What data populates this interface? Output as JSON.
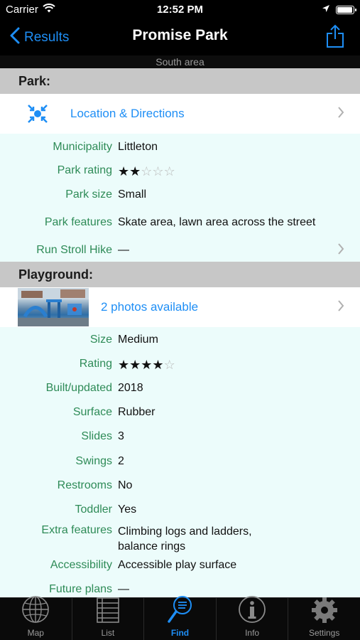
{
  "status_bar": {
    "carrier": "Carrier",
    "time": "12:52 PM",
    "battery_level": 0.95
  },
  "nav": {
    "back_label": "Results",
    "title": "Promise Park",
    "subtitle": "South area"
  },
  "park": {
    "header": "Park:",
    "directions_label": "Location & Directions",
    "rows": [
      {
        "label": "Municipality",
        "value": "Littleton"
      },
      {
        "label": "Park rating",
        "stars": 2,
        "max_stars": 5
      },
      {
        "label": "Park size",
        "value": "Small"
      },
      {
        "label": "Park features",
        "value": "Skate area, lawn area across the street"
      },
      {
        "label": "Run Stroll Hike",
        "value": "—"
      }
    ]
  },
  "playground": {
    "header": "Playground:",
    "photos_label": "2 photos available",
    "rows": [
      {
        "label": "Size",
        "value": "Medium"
      },
      {
        "label": "Rating",
        "stars": 4,
        "max_stars": 5
      },
      {
        "label": "Built/updated",
        "value": "2018"
      },
      {
        "label": "Surface",
        "value": "Rubber"
      },
      {
        "label": "Slides",
        "value": "3"
      },
      {
        "label": "Swings",
        "value": "2"
      },
      {
        "label": "Restrooms",
        "value": "No"
      },
      {
        "label": "Toddler",
        "value": "Yes"
      },
      {
        "label": "Extra features",
        "value_line1": "Climbing logs and ladders,",
        "value_line2": "balance rings"
      },
      {
        "label": "Accessibility",
        "value": "Accessible play surface"
      },
      {
        "label": "Future plans",
        "value": "—"
      }
    ]
  },
  "tabs": [
    {
      "label": "Map",
      "icon": "globe-icon"
    },
    {
      "label": "List",
      "icon": "list-icon"
    },
    {
      "label": "Find",
      "icon": "find-icon",
      "active": true
    },
    {
      "label": "Info",
      "icon": "info-icon"
    },
    {
      "label": "Settings",
      "icon": "gear-icon"
    }
  ],
  "colors": {
    "accent": "#1e8ef5",
    "label_green": "#2e8b57",
    "content_bg": "#ecfcfb",
    "section_gray": "#c7c7c7"
  }
}
